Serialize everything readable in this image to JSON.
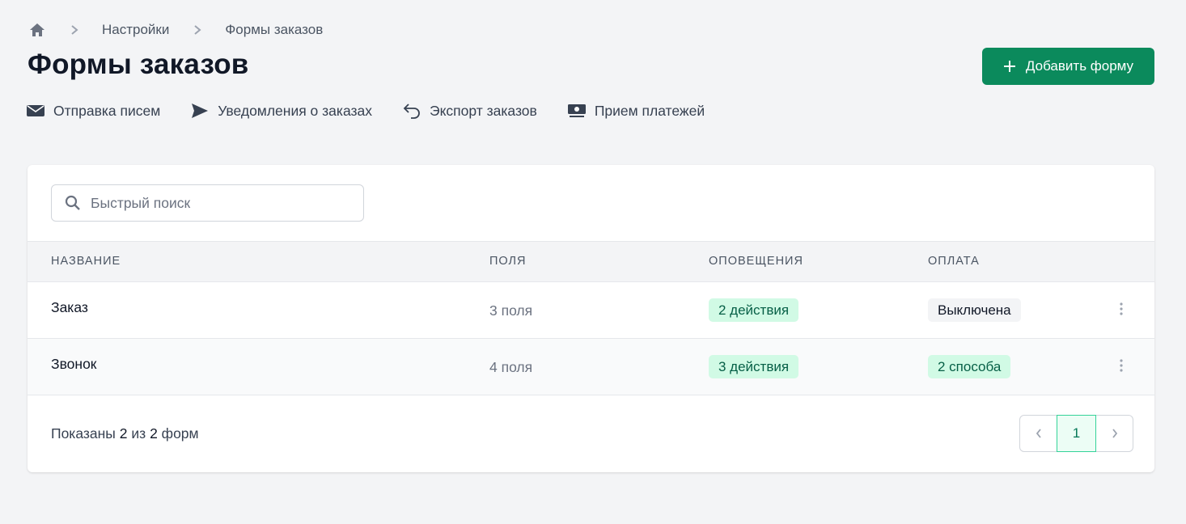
{
  "breadcrumb": {
    "home_icon": "home-icon",
    "items": [
      "Настройки",
      "Формы заказов"
    ]
  },
  "page_title": "Формы заказов",
  "add_button": {
    "label": "Добавить форму",
    "icon": "plus-icon",
    "color": "#0b8a5c"
  },
  "subnav": [
    {
      "label": "Отправка писем",
      "icon": "envelope-icon"
    },
    {
      "label": "Уведомления о заказах",
      "icon": "paper-plane-icon"
    },
    {
      "label": "Экспорт заказов",
      "icon": "reply-arrow-icon"
    },
    {
      "label": "Прием платежей",
      "icon": "cash-icon"
    }
  ],
  "search": {
    "placeholder": "Быстрый поиск",
    "value": ""
  },
  "table": {
    "headers": {
      "name": "НАЗВАНИЕ",
      "fields": "ПОЛЯ",
      "notifications": "ОПОВЕЩЕНИЯ",
      "payment": "ОПЛАТА"
    },
    "rows": [
      {
        "name": "Заказ",
        "fields": "3 поля",
        "notifications": "2 действия",
        "payment": "Выключена",
        "payment_status": "gray"
      },
      {
        "name": "Звонок",
        "fields": "4 поля",
        "notifications": "3 действия",
        "payment": "2 способа",
        "payment_status": "green"
      }
    ]
  },
  "footer": {
    "prefix": "Показаны",
    "shown": "2",
    "middle": "из",
    "total": "2",
    "suffix": "форм"
  },
  "pagination": {
    "current_page": "1"
  }
}
